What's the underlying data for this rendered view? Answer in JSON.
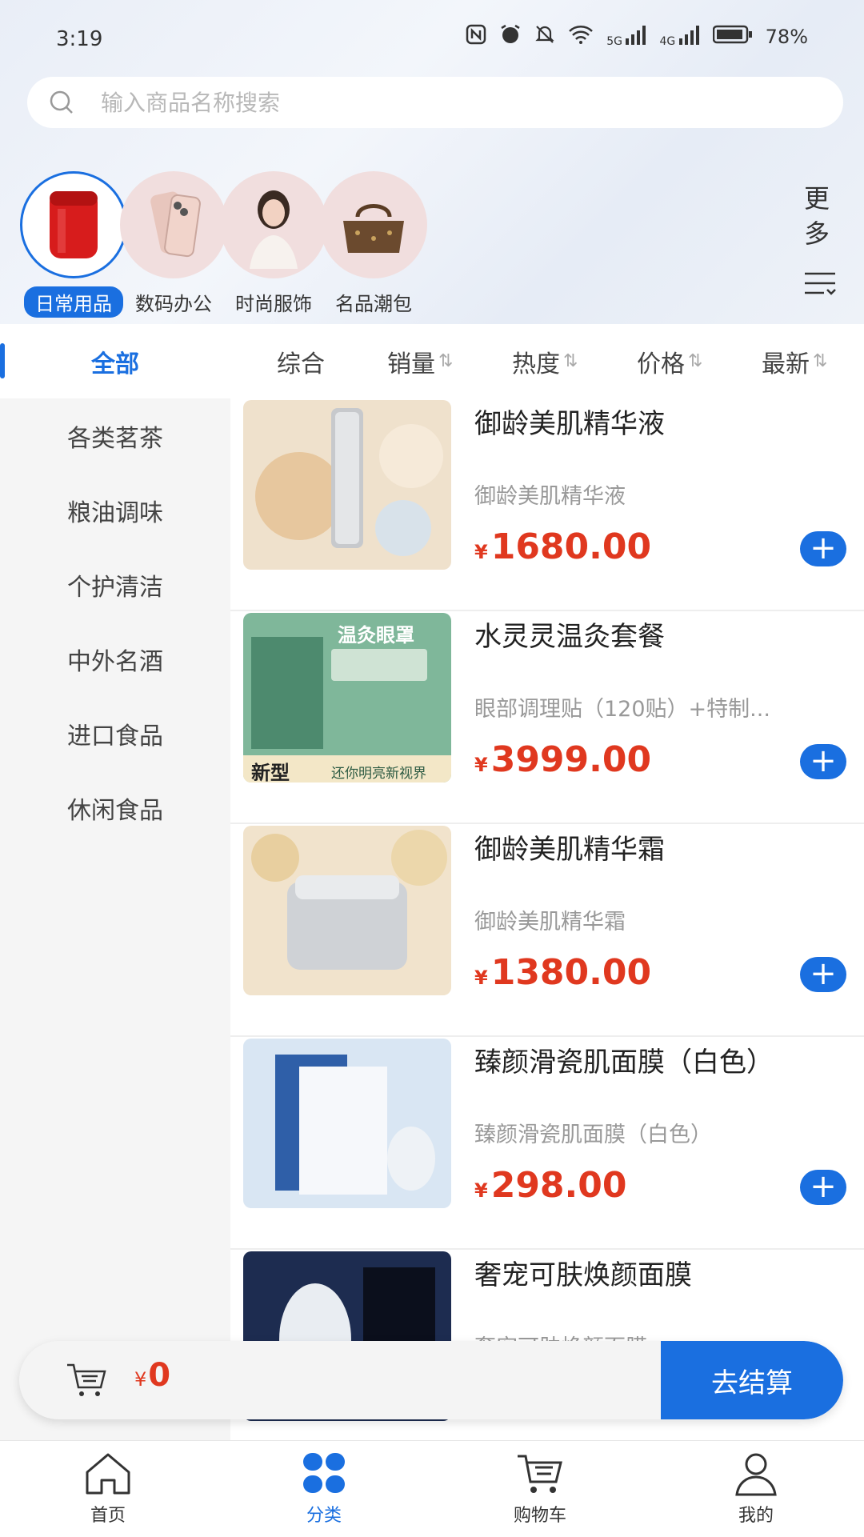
{
  "status": {
    "time": "3:19",
    "battery": "78%",
    "net_5g": "5G",
    "net_4g": "4G"
  },
  "search": {
    "placeholder": "输入商品名称搜索"
  },
  "categories": [
    {
      "label": "日常用品",
      "active": true
    },
    {
      "label": "数码办公",
      "active": false
    },
    {
      "label": "时尚服饰",
      "active": false
    },
    {
      "label": "名品潮包",
      "active": false
    }
  ],
  "more_label_1": "更",
  "more_label_2": "多",
  "left_nav": [
    {
      "label": "全部"
    },
    {
      "label": "各类茗茶"
    },
    {
      "label": "粮油调味"
    },
    {
      "label": "个护清洁"
    },
    {
      "label": "中外名酒"
    },
    {
      "label": "进口食品"
    },
    {
      "label": "休闲食品"
    }
  ],
  "sort": [
    {
      "label": "综合"
    },
    {
      "label": "销量"
    },
    {
      "label": "热度"
    },
    {
      "label": "价格"
    },
    {
      "label": "最新"
    }
  ],
  "currency": "¥",
  "products": [
    {
      "title": "御龄美肌精华液",
      "subtitle": "御龄美肌精华液",
      "price": "1680.00",
      "image_colors": [
        "#efe1cc",
        "#d8c7ae"
      ]
    },
    {
      "title": "水灵灵温灸套餐",
      "subtitle": "眼部调理贴（120贴）+特制...",
      "price": "3999.00",
      "image_colors": [
        "#7fb79a",
        "#4d8a6e"
      ],
      "image_caption_1": "新型",
      "image_caption_2": "还你明亮新视界",
      "image_caption_3": "温灸眼罩"
    },
    {
      "title": "御龄美肌精华霜",
      "subtitle": "御龄美肌精华霜",
      "price": "1380.00",
      "image_colors": [
        "#f1e3cc",
        "#e2d0b2"
      ]
    },
    {
      "title": "臻颜滑瓷肌面膜（白色）",
      "subtitle": "臻颜滑瓷肌面膜（白色）",
      "price": "298.00",
      "image_colors": [
        "#d9e6f3",
        "#bcd2ea"
      ]
    },
    {
      "title": "奢宠可肤焕颜面膜",
      "subtitle": "奢宠可肤焕颜面膜",
      "price": "",
      "image_colors": [
        "#1d2c50",
        "#0f1a33"
      ]
    }
  ],
  "cart": {
    "total": "0",
    "checkout_label": "去结算"
  },
  "tabs": [
    {
      "label": "首页"
    },
    {
      "label": "分类"
    },
    {
      "label": "购物车"
    },
    {
      "label": "我的"
    }
  ],
  "colors": {
    "accent": "#1a6fe0",
    "price": "#e0381f"
  }
}
